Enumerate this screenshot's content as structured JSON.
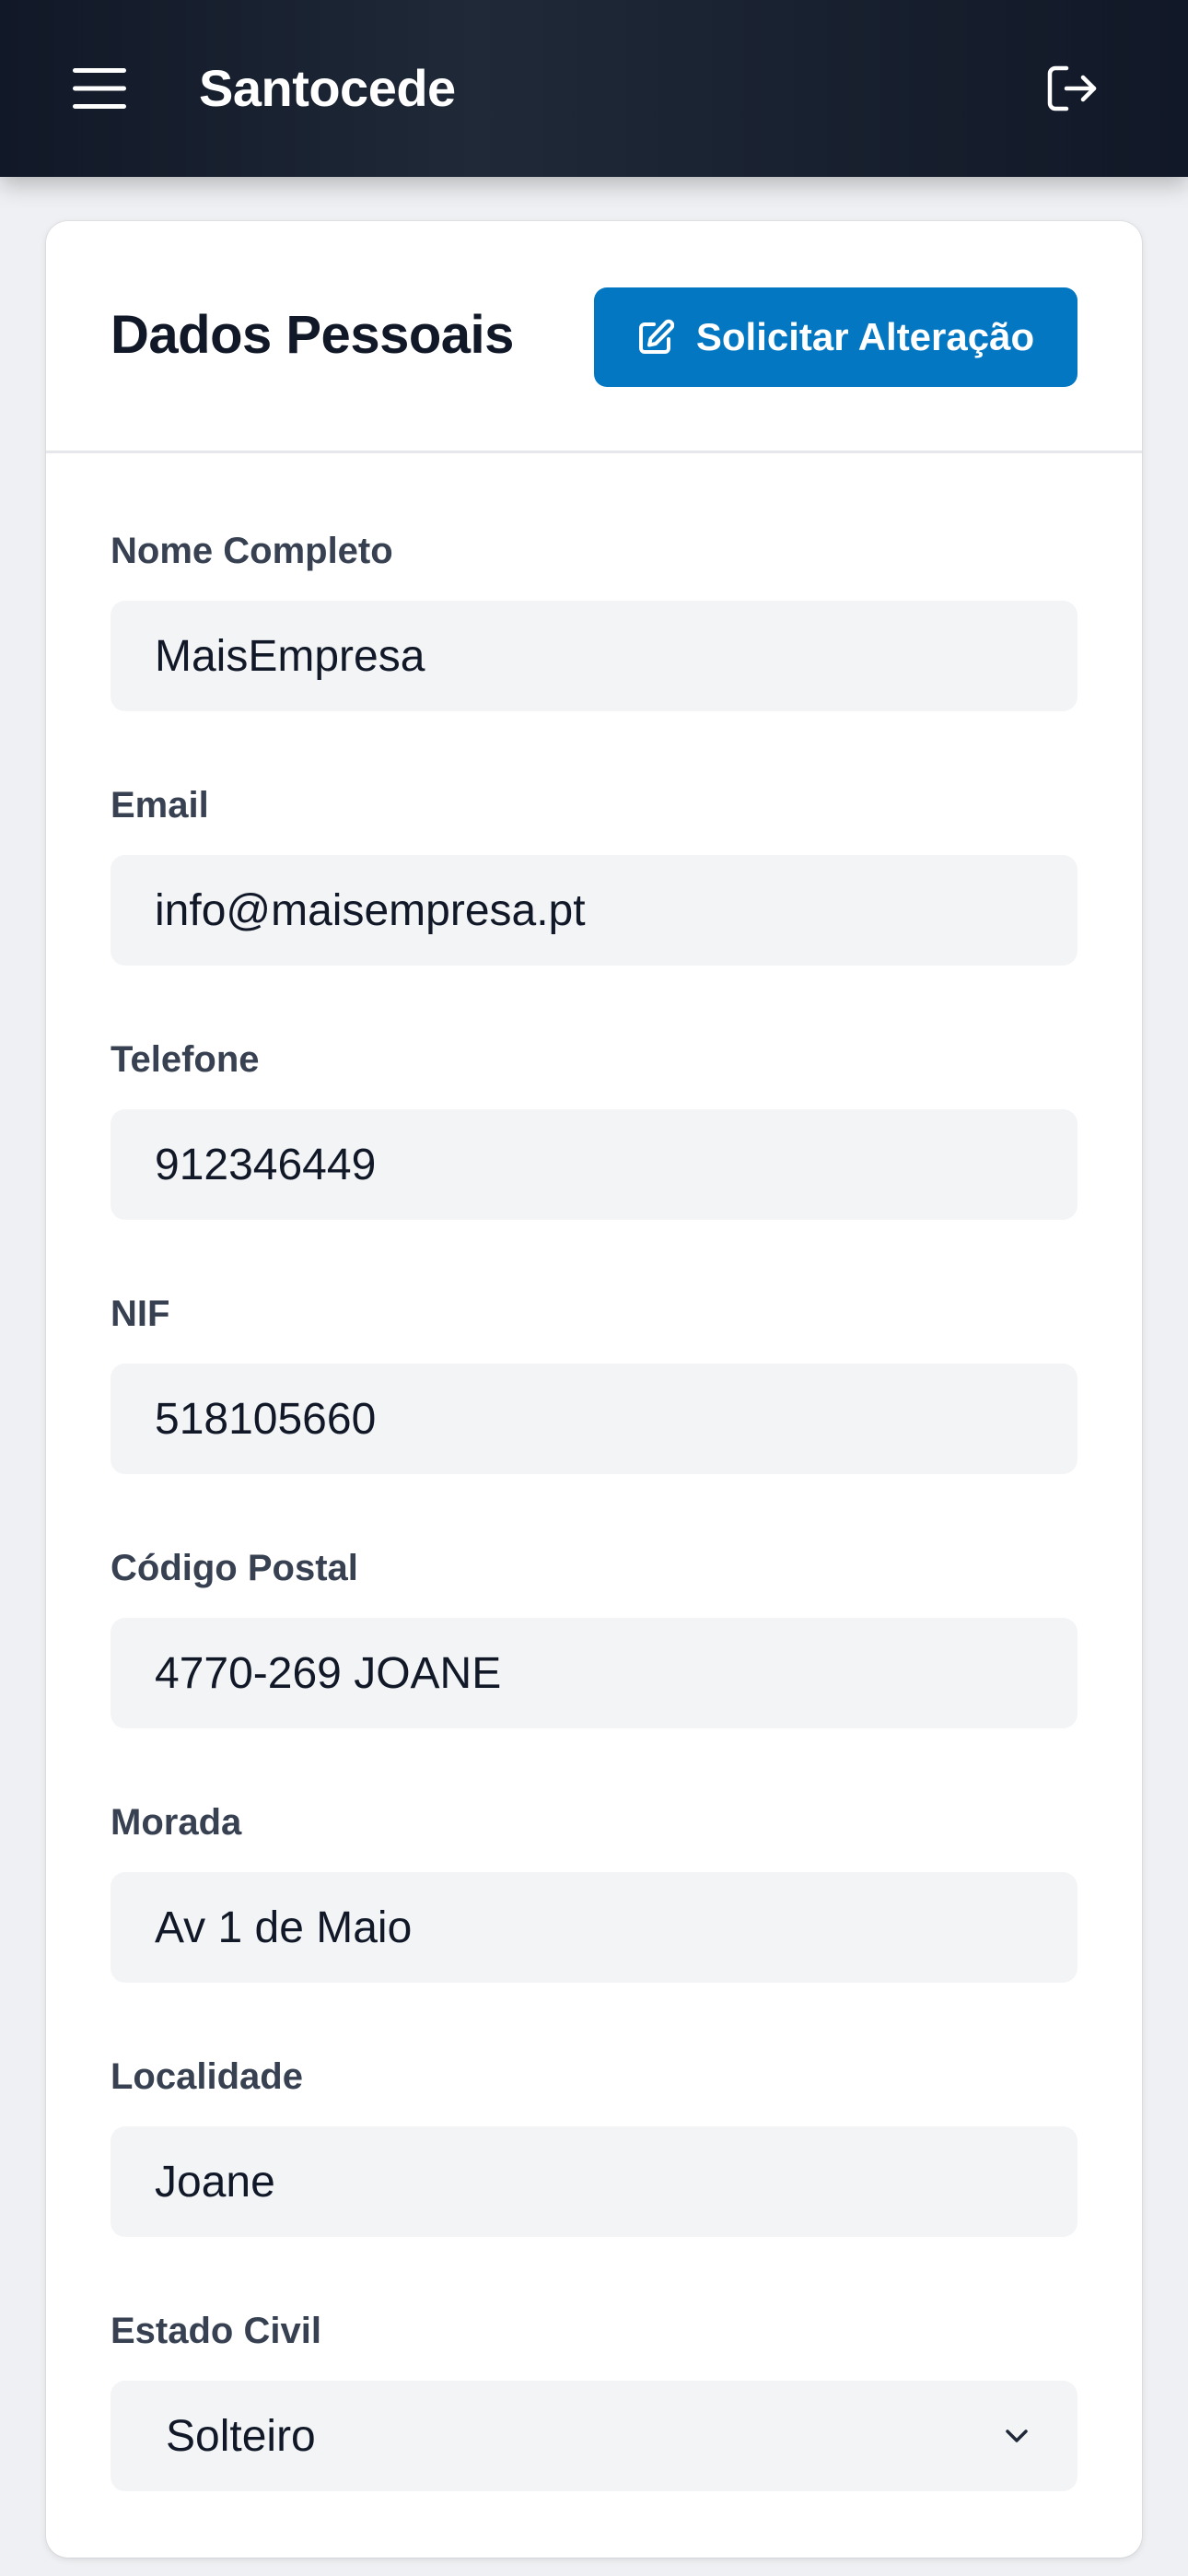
{
  "header": {
    "brand": "Santocede",
    "menu_icon": "menu-icon",
    "logout_icon": "logout-icon"
  },
  "card": {
    "title": "Dados Pessoais",
    "request_button_label": "Solicitar Alteração",
    "request_button_icon": "edit-icon",
    "accent_color": "#0477c3"
  },
  "fields": {
    "nome": {
      "label": "Nome Completo",
      "value": "MaisEmpresa"
    },
    "email": {
      "label": "Email",
      "value": "info@maisempresa.pt"
    },
    "telefone": {
      "label": "Telefone",
      "value": "912346449"
    },
    "nif": {
      "label": "NIF",
      "value": "518105660"
    },
    "codigo_postal": {
      "label": "Código Postal",
      "value": "4770-269 JOANE"
    },
    "morada": {
      "label": "Morada",
      "value": "Av 1 de Maio"
    },
    "localidade": {
      "label": "Localidade",
      "value": "Joane"
    },
    "estado_civil": {
      "label": "Estado Civil",
      "value": "Solteiro"
    }
  }
}
